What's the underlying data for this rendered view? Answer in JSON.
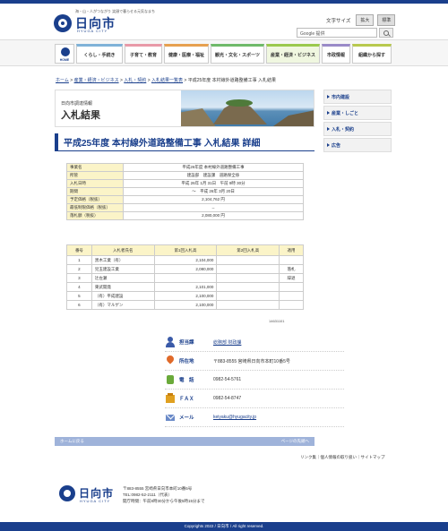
{
  "header": {
    "tagline": "海・山・人がつながり 笑顔で暮らせる元気なまち",
    "city_name": "日向市",
    "city_name_en": "HYUGA CITY",
    "fontsize_label": "文字サイズ",
    "fontsize_large": "拡大",
    "fontsize_standard": "標準",
    "search_placeholder": "Google 提供"
  },
  "nav": {
    "home_label": "HOME",
    "items": [
      {
        "label": "くらし・手続き",
        "color": "#7fb2d8"
      },
      {
        "label": "子育て・教育",
        "color": "#e89aa8"
      },
      {
        "label": "健康・医療・福祉",
        "color": "#e6a050"
      },
      {
        "label": "観光・文化・スポーツ",
        "color": "#6fba6a"
      },
      {
        "label": "産業・経済・ビジネス",
        "color": "#9bc94e"
      },
      {
        "label": "市政情報",
        "color": "#9a8ac8"
      },
      {
        "label": "組織から探す",
        "color": "#b8c94e"
      }
    ]
  },
  "breadcrumb": {
    "items": [
      "ホーム",
      "産業・経済・ビジネス",
      "入札・契約",
      "入札結果一覧表"
    ],
    "separator": ">",
    "current": "平成25年度 本村線外道路整備工事 入札結果"
  },
  "banner": {
    "subtitle": "日向市調達情報",
    "title": "入札結果"
  },
  "sidenav": {
    "items": [
      "市内建設",
      "産業・しごと",
      "入札・契約",
      "広告"
    ]
  },
  "page_title": "平成25年度 本村線外道路整備工事 入札結果 詳細",
  "info_table": {
    "rows": [
      {
        "key": "事業名",
        "value": "平成26年度 本村線外道路整備工事"
      },
      {
        "key": "所管",
        "value": "建設部　建設課　道路保全係"
      },
      {
        "key": "入札日時",
        "value": "平成 26年 1月 31日　午前 9時 30分"
      },
      {
        "key": "期間",
        "value": "〜　平成 26年 3月 20日"
      },
      {
        "key": "予定価格（税抜）",
        "value": "2,104,762 円"
      },
      {
        "key": "最低制限価格（税抜）",
        "value": "--"
      },
      {
        "key": "落札額（税抜）",
        "value": "2,080,000 円"
      }
    ]
  },
  "results_table": {
    "headers": [
      "番号",
      "入札者氏名",
      "第1回入札高",
      "第2回入札高",
      "適用"
    ],
    "rows": [
      {
        "no": "1",
        "name": "黒木工業（有）",
        "amt1": "2,104,000",
        "amt2": "",
        "note": ""
      },
      {
        "no": "2",
        "name": "児玉建設工業",
        "amt1": "2,080,000",
        "amt2": "",
        "note": "落札"
      },
      {
        "no": "3",
        "name": "辻左瀬",
        "amt1": "",
        "amt2": "",
        "note": "辞退"
      },
      {
        "no": "4",
        "name": "東武開発",
        "amt1": "2,101,000",
        "amt2": "",
        "note": ""
      },
      {
        "no": "5",
        "name": "（有）平成建設",
        "amt1": "2,100,000",
        "amt2": "",
        "note": ""
      },
      {
        "no": "6",
        "name": "（有）マルゲン",
        "amt1": "2,100,000",
        "amt2": "",
        "note": ""
      }
    ]
  },
  "page_id": "14631101",
  "contact": {
    "dept_label": "担当課",
    "dept_value": "総務部 財政課",
    "address_label": "所在地",
    "address_value": "〒883-8555 宮崎県日向市本町10番5号",
    "phone_label": "電　話",
    "phone_value": "0982-54-5761",
    "fax_label": "ＦＡＸ",
    "fax_value": "0982-54-8747",
    "mail_label": "メール",
    "mail_value": "keiyaku@hyugacity.jp"
  },
  "footnav": {
    "back": "ホームに戻る",
    "top": "ページの先頭へ"
  },
  "footer_links": "リンク集｜個人情報の取り扱い｜サイトマップ",
  "footer": {
    "name": "日向市",
    "name_en": "HYUGA CITY",
    "address": "〒883-8555 宮崎県日向市本町10番5号",
    "tel": "TEL:0982-52-2111（代表）",
    "hours": "開庁時間：午前8時30分から午後5時15分まで",
    "copyright": "Copyrights 2022 / 日向市 / All right reserved."
  }
}
